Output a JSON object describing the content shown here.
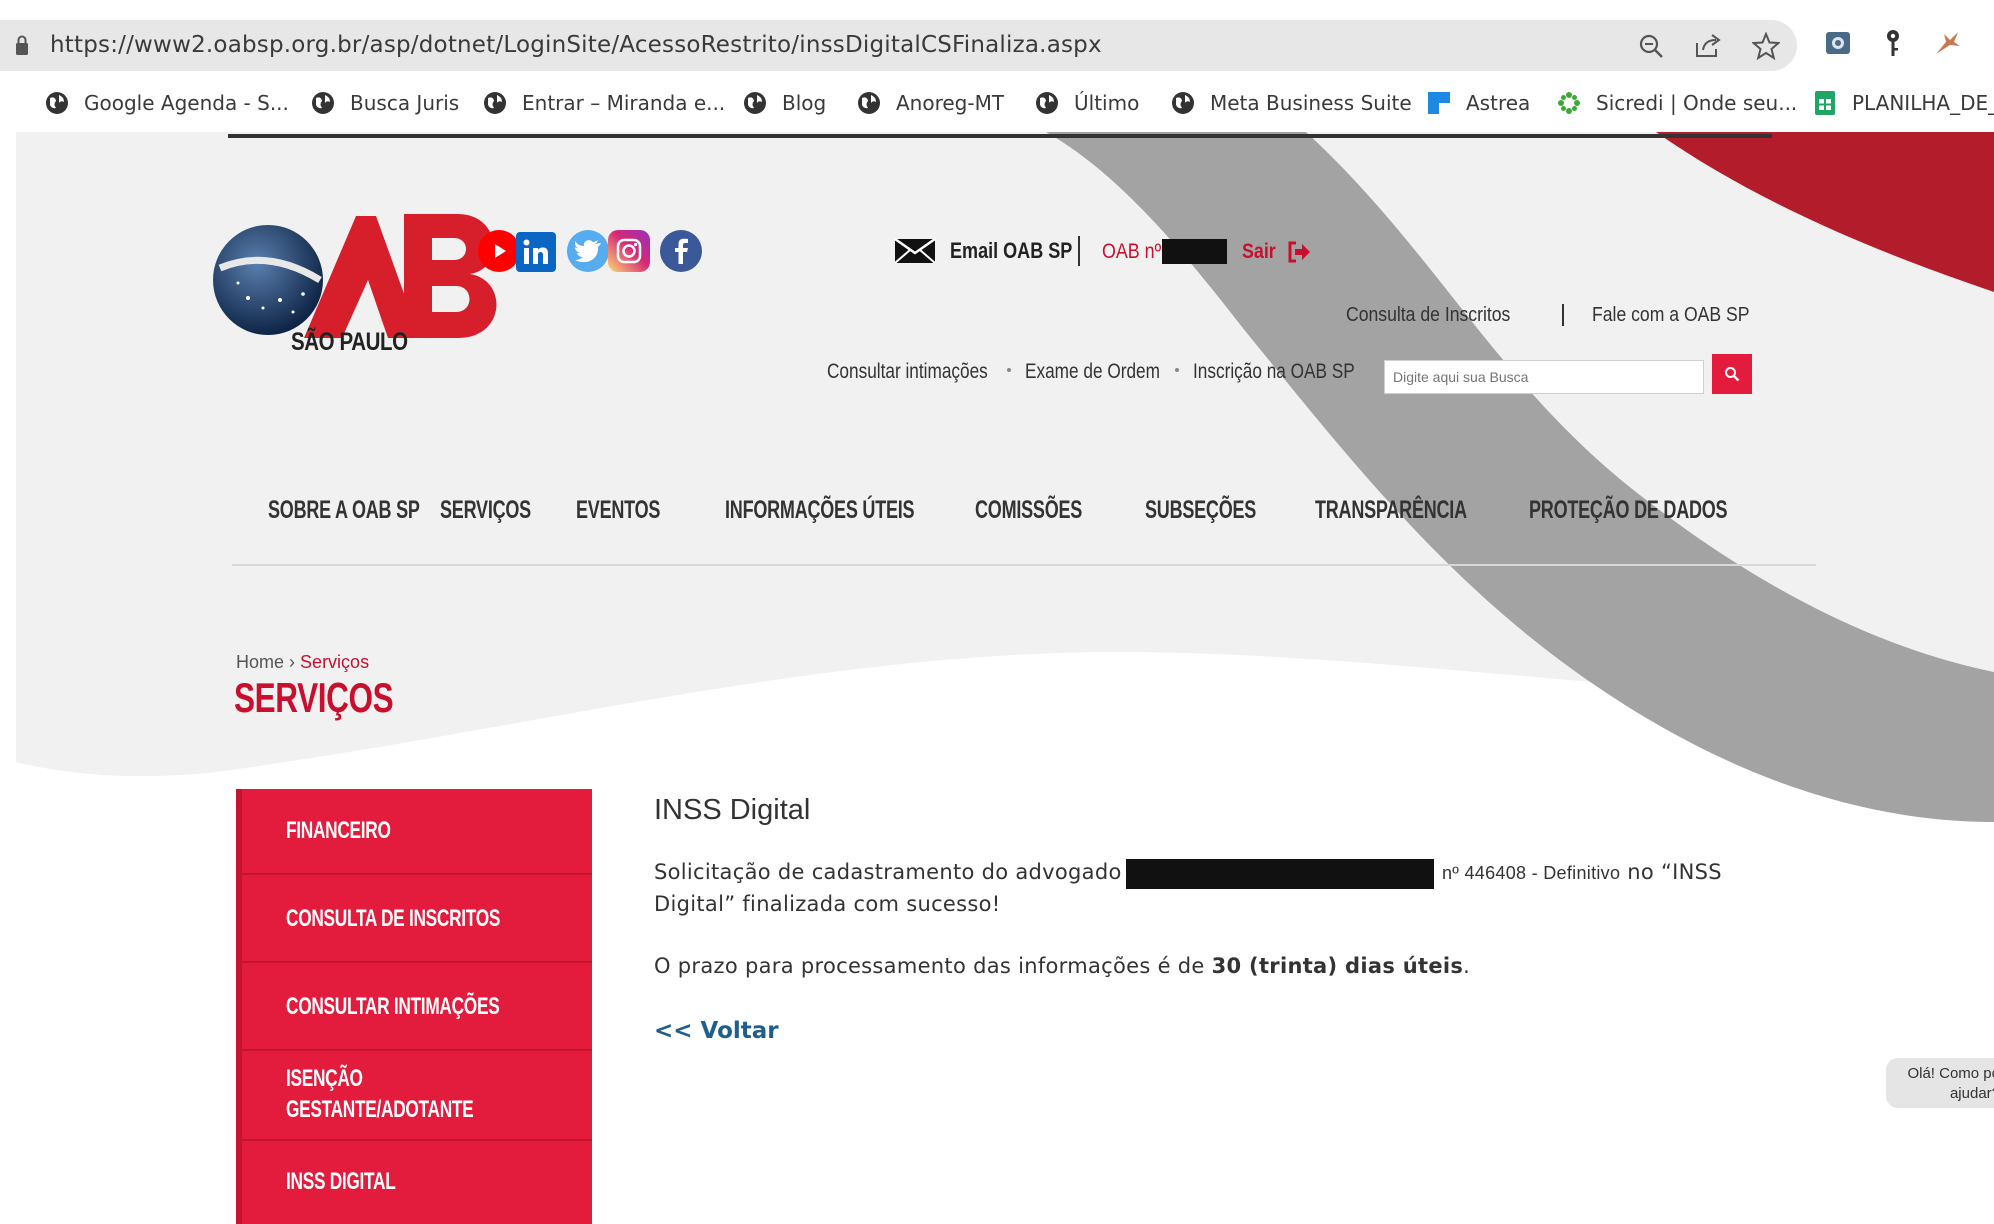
{
  "browser": {
    "url": "https://www2.oabsp.org.br/asp/dotnet/LoginSite/AcessoRestrito/inssDigitalCSFinaliza.aspx",
    "bookmarks": [
      {
        "label": "Google Agenda - S...",
        "icon": "globe-icon"
      },
      {
        "label": "Busca Juris",
        "icon": "globe-icon"
      },
      {
        "label": "Entrar – Miranda e...",
        "icon": "globe-icon"
      },
      {
        "label": "Blog",
        "icon": "globe-icon"
      },
      {
        "label": "Anoreg-MT",
        "icon": "globe-icon"
      },
      {
        "label": "Último",
        "icon": "globe-icon"
      },
      {
        "label": "Meta Business Suite",
        "icon": "globe-icon"
      },
      {
        "label": "Astrea",
        "icon": "astrea-icon"
      },
      {
        "label": "Sicredi | Onde seu...",
        "icon": "sicredi-icon"
      },
      {
        "label": "PLANILHA_DE_",
        "icon": "sheets-icon"
      }
    ]
  },
  "header": {
    "logo_sub": "SÃO PAULO",
    "email_label": "Email OAB SP",
    "oab_label": "OAB nº",
    "logout_label": "Sair",
    "top_links": [
      "Consulta de Inscritos",
      "Fale com a OAB SP"
    ],
    "quick_links": [
      "Consultar intimações",
      "Exame de Ordem",
      "Inscrição na OAB SP"
    ],
    "search_placeholder": "Digite aqui sua Busca"
  },
  "nav": [
    "SOBRE A OAB SP",
    "SERVIÇOS",
    "EVENTOS",
    "INFORMAÇÕES ÚTEIS",
    "COMISSÕES",
    "SUBSEÇÕES",
    "TRANSPARÊNCIA",
    "PROTEÇÃO DE DADOS"
  ],
  "breadcrumb": {
    "home": "Home",
    "separator": "›",
    "current": "Serviços"
  },
  "page_title": "SERVIÇOS",
  "sidebar": [
    "FINANCEIRO",
    "CONSULTA DE INSCRITOS",
    "CONSULTAR INTIMAÇÕES",
    "ISENÇÃO",
    "GESTANTE/ADOTANTE",
    "INSS DIGITAL"
  ],
  "content": {
    "title": "INSS Digital",
    "p1_start": "Solicitação de cadastramento do advogado",
    "p1_number": "nº 446408 - Definitivo",
    "p1_end": "no “INSS",
    "p1_line2": "Digital” finalizada com sucesso!",
    "p2_start": "O prazo para processamento das informações é de",
    "p2_bold": "30 (trinta) dias úteis",
    "p2_end": ".",
    "back_link": "<< Voltar"
  },
  "chat": {
    "line1": "Olá! Como po",
    "line2": "ajudar?"
  },
  "colors": {
    "brand_red": "#e31c3d",
    "dark_red": "#c8102e",
    "link_blue": "#1f5f8b",
    "swoosh_gray": "#a3a3a3",
    "bg_light": "#f1f1f1"
  }
}
